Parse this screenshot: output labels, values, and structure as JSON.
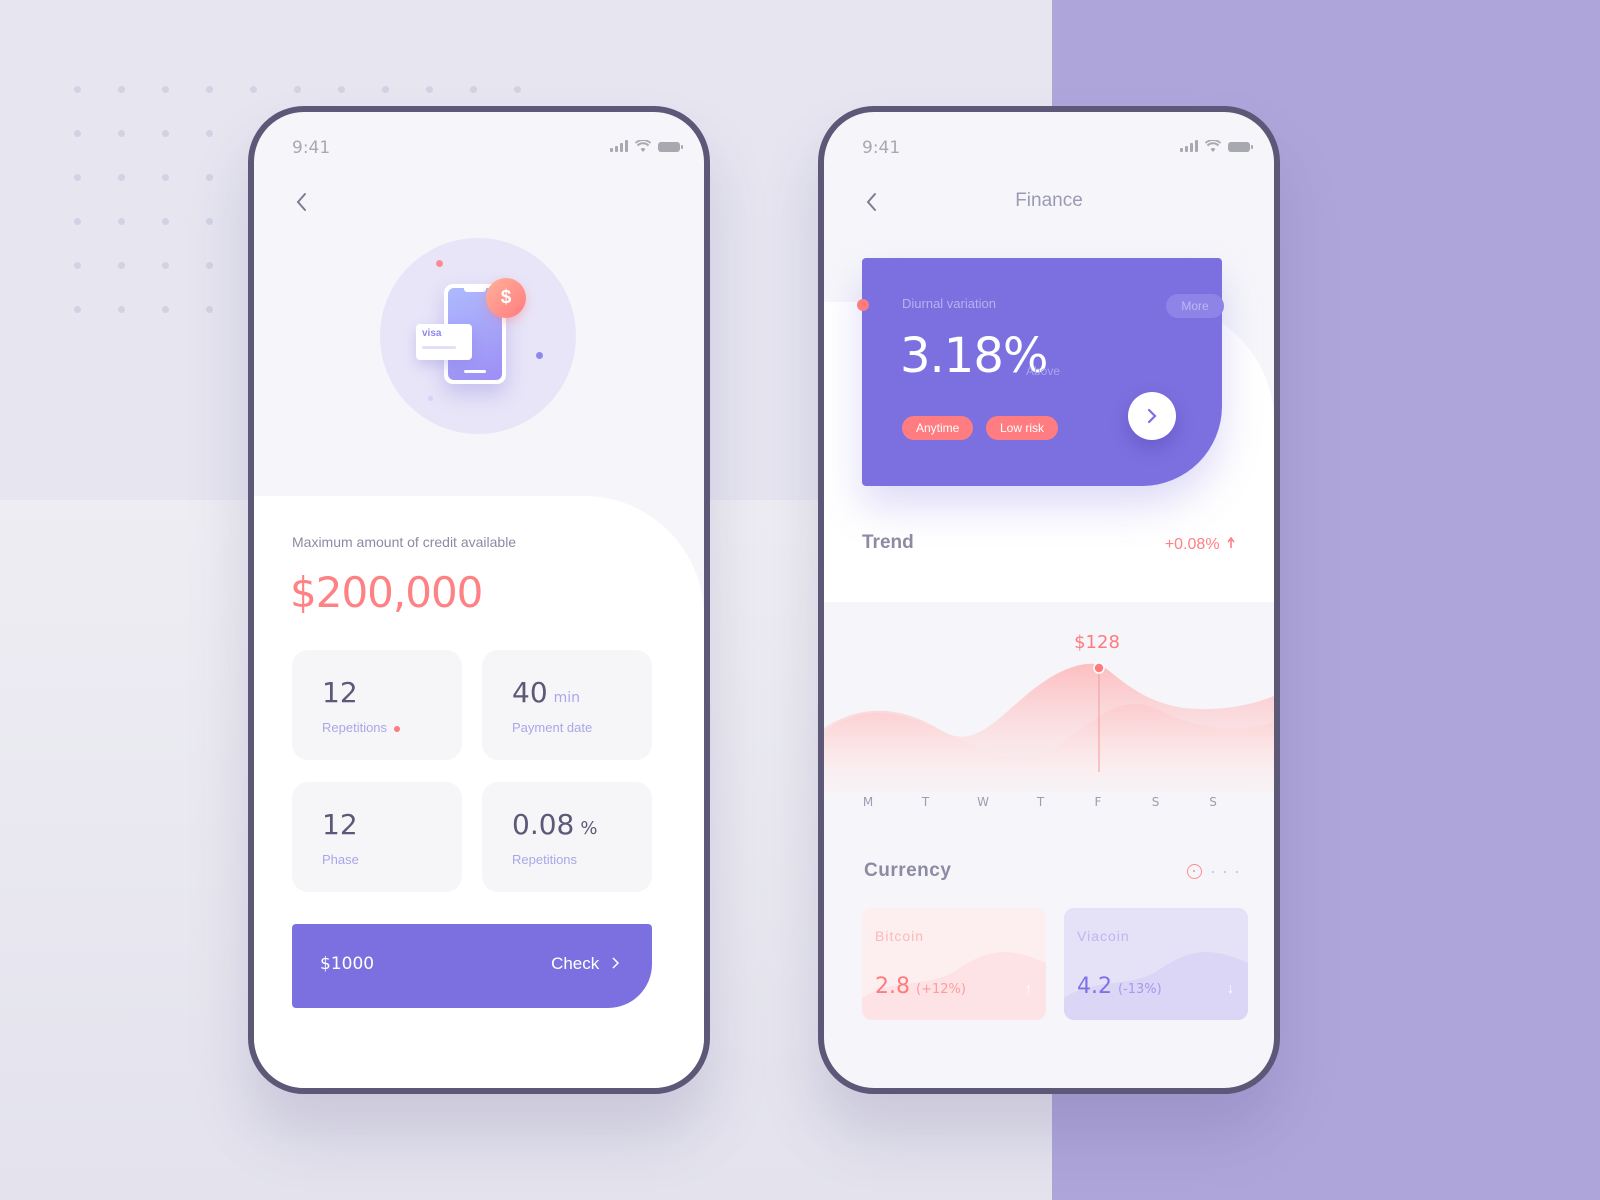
{
  "left_phone": {
    "status": {
      "time": "9:41"
    },
    "back_icon": "chevron-left-icon",
    "illustration": {
      "card_brand": "visa",
      "coin_symbol": "$"
    },
    "credit": {
      "label": "Maximum amount of credit available",
      "value": "$200,000"
    },
    "stats": [
      {
        "value": "12",
        "unit": "",
        "label": "Repetitions",
        "indicator": true
      },
      {
        "value": "40",
        "unit": "min",
        "label": "Payment date",
        "indicator": false
      },
      {
        "value": "12",
        "unit": "",
        "label": "Phase",
        "indicator": false
      },
      {
        "value": "0.08",
        "unit": "%",
        "label": "Repetitions",
        "indicator": false
      }
    ],
    "action": {
      "amount": "$1000",
      "label": "Check",
      "icon": "chevron-right-icon"
    }
  },
  "right_phone": {
    "status": {
      "time": "9:41"
    },
    "title": "Finance",
    "variation": {
      "label": "Diurnal variation",
      "more_label": "More",
      "value": "3.18%",
      "qualifier": "Above",
      "tags": [
        "Anytime",
        "Low risk"
      ]
    },
    "trend": {
      "title": "Trend",
      "delta": "+0.08%",
      "delta_icon": "arrow-up-icon",
      "tooltip": "$128",
      "days": [
        "M",
        "T",
        "W",
        "T",
        "F",
        "S",
        "S"
      ],
      "highlight_index": 4
    },
    "currency": {
      "title": "Currency",
      "page_count": 4,
      "active_page": 0,
      "items": [
        {
          "name": "Bitcoin",
          "value": "2.8",
          "change": "(+12%)",
          "direction": "up"
        },
        {
          "name": "Viacoin",
          "value": "4.2",
          "change": "(-13%)",
          "direction": "down"
        }
      ]
    }
  },
  "colors": {
    "accent_purple": "#7c70e0",
    "accent_coral": "#fe8183",
    "text_dark": "#5d5877",
    "text_muted": "#8c8ba3",
    "background_lilac": "#aea6db"
  }
}
